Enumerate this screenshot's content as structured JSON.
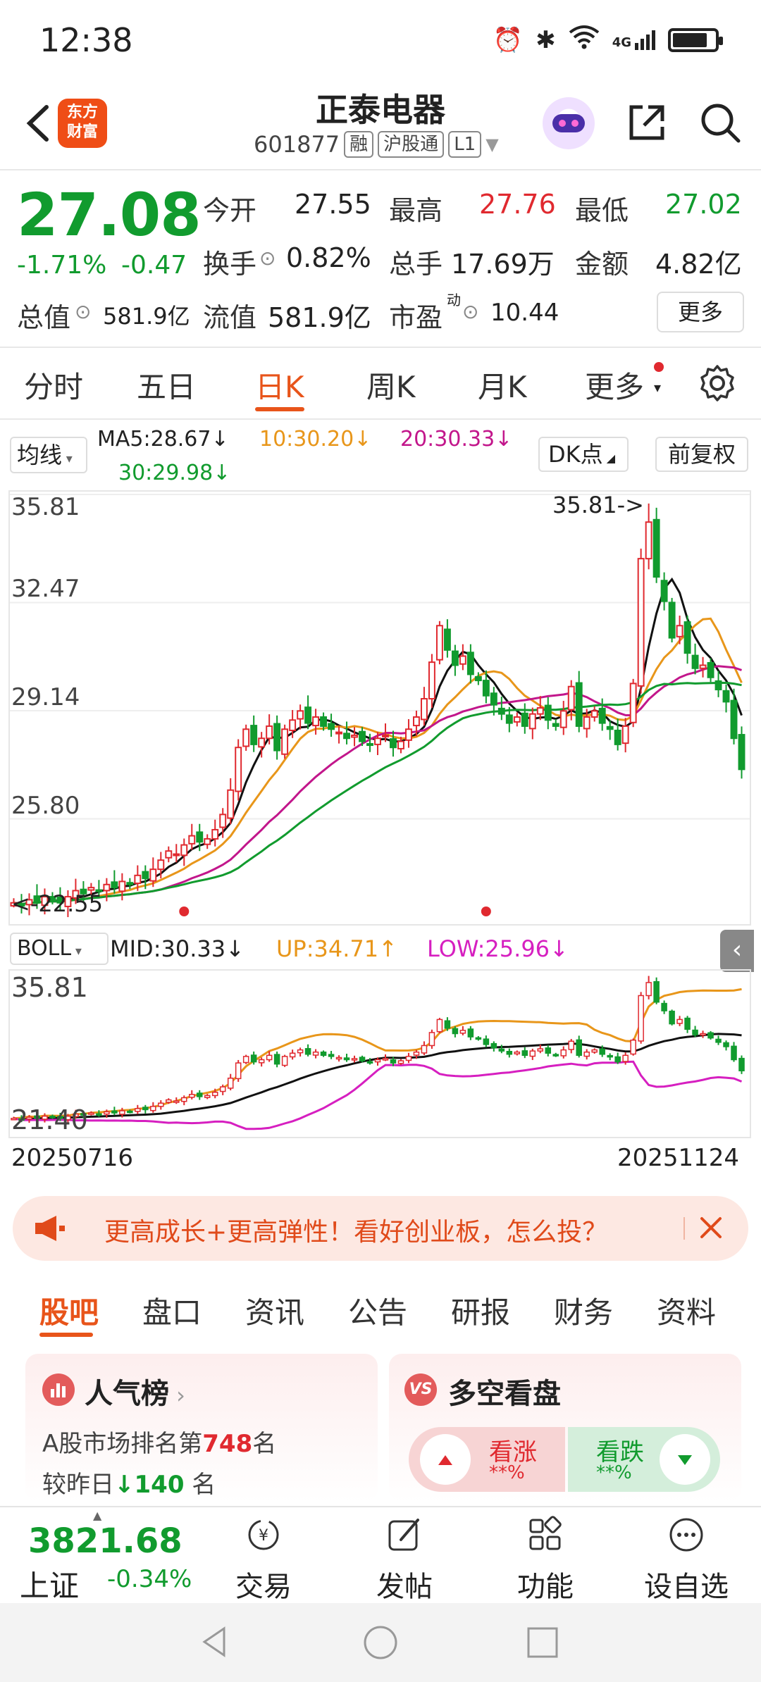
{
  "status": {
    "time": "12:38",
    "network": "4G"
  },
  "header": {
    "logo_text_1": "东方",
    "logo_text_2": "财富",
    "name": "正泰电器",
    "code": "601877",
    "tag_margin": "融",
    "tag_connect": "沪股通",
    "tag_level": "L1"
  },
  "quote": {
    "price": "27.08",
    "pct": "-1.71%",
    "chg": "-0.47",
    "open_label": "今开",
    "open": "27.55",
    "high_label": "最高",
    "high": "27.76",
    "low_label": "最低",
    "low": "27.02",
    "turnover_label": "换手",
    "turnover": "0.82%",
    "volume_label": "总手",
    "volume": "17.69万",
    "amount_label": "金额",
    "amount": "4.82亿",
    "mktcap_label": "总值",
    "mktcap": "581.9亿",
    "float_label": "流值",
    "float": "581.9亿",
    "pe_label": "市盈",
    "pe_sup": "动",
    "pe": "10.44",
    "more_label": "更多"
  },
  "period_tabs": [
    "分时",
    "五日",
    "日K",
    "周K",
    "月K",
    "更多"
  ],
  "active_period": 2,
  "indicators": {
    "ma_select": "均线",
    "ma5": "MA5:28.67↓",
    "ma10": "10:30.20↓",
    "ma20": "20:30.33↓",
    "ma30": "30:29.98↓",
    "dk_label": "DK点",
    "fq_label": "前复权"
  },
  "chart_data": {
    "type": "candlestick",
    "y_labels": [
      "35.81",
      "32.47",
      "29.14",
      "25.80"
    ],
    "ylim": [
      22.0,
      36.2
    ],
    "high_marker": "35.81->",
    "low_marker": "<-22.55",
    "x_start": "20250716",
    "x_end": "20251124",
    "colors": {
      "up": "#e0292f",
      "down": "#119b2e",
      "ma5": "#111111",
      "ma10": "#e8961a",
      "ma20": "#c2168b",
      "ma30": "#119b2e"
    },
    "closes": [
      22.7,
      22.6,
      22.8,
      22.7,
      22.9,
      22.8,
      22.7,
      22.9,
      23.1,
      23.0,
      23.2,
      23.1,
      23.3,
      23.2,
      23.4,
      23.3,
      23.6,
      23.5,
      23.8,
      24.1,
      24.4,
      24.3,
      24.6,
      24.9,
      24.7,
      24.8,
      25.1,
      25.6,
      26.4,
      27.8,
      28.4,
      27.9,
      28.1,
      28.5,
      27.7,
      28.4,
      28.7,
      29.0,
      28.6,
      28.8,
      28.5,
      28.4,
      28.3,
      28.1,
      28.2,
      28.0,
      27.9,
      28.1,
      28.2,
      27.8,
      28.0,
      28.4,
      28.8,
      29.4,
      30.6,
      31.8,
      31.0,
      30.5,
      30.8,
      30.2,
      30.0,
      29.5,
      29.2,
      28.9,
      28.6,
      28.8,
      28.5,
      28.9,
      29.1,
      28.7,
      28.5,
      29.0,
      29.8,
      28.5,
      28.8,
      29.0,
      28.6,
      28.4,
      27.9,
      28.5,
      29.9,
      34.0,
      35.2,
      33.4,
      32.6,
      31.4,
      31.8,
      30.9,
      30.4,
      30.5,
      30.1,
      29.7,
      29.3,
      28.1,
      27.08
    ],
    "boll_labels": {
      "mid": "MID:30.33↓",
      "up": "UP:34.71↑",
      "low": "LOW:25.96↓",
      "select": "BOLL"
    },
    "boll_y_labels": [
      "35.81",
      "21.40"
    ],
    "boll_ylim": [
      21.0,
      36.3
    ]
  },
  "promo": {
    "text": "更高成长+更高弹性！看好创业板，怎么投？"
  },
  "content_tabs": [
    "股吧",
    "盘口",
    "资讯",
    "公告",
    "研报",
    "财务",
    "资料"
  ],
  "popularity": {
    "title": "人气榜",
    "rank_prefix": "A股市场排名第",
    "rank": "748",
    "rank_suffix": "名",
    "change_prefix": "较昨日",
    "change": "140",
    "change_suffix": "名"
  },
  "bull_bear": {
    "title": "多空看盘",
    "bull_label": "看涨",
    "bull_val": "**%",
    "bear_label": "看跌",
    "bear_val": "**%"
  },
  "index": {
    "value": "3821.68",
    "name": "上证",
    "pct": "-0.34%"
  },
  "bottom_nav": [
    "交易",
    "发帖",
    "功能",
    "设自选"
  ]
}
